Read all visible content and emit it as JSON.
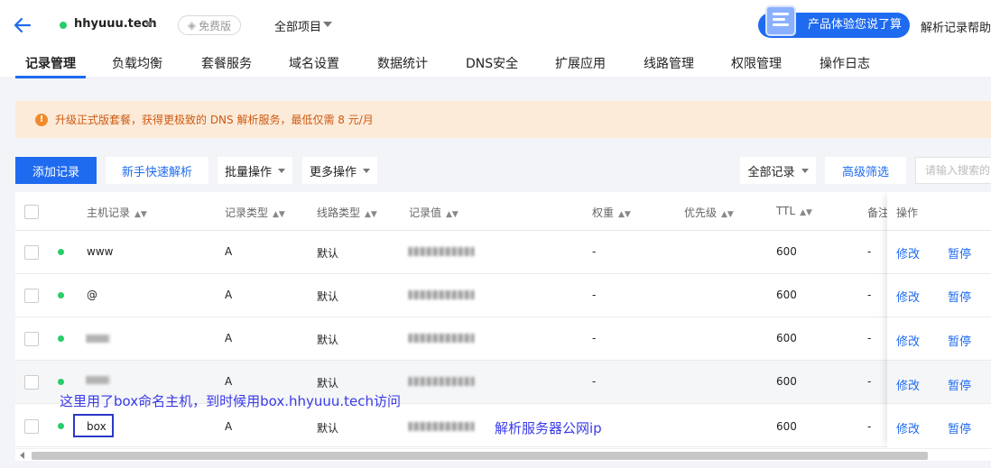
{
  "header": {
    "domain": "hhyuuu.tech",
    "plan_badge": "免费版",
    "project_filter": "全部项目",
    "promo_label": "产品体验您说了算",
    "help_text": "解析记录帮助指南"
  },
  "tabs": [
    {
      "label": "记录管理",
      "active": true
    },
    {
      "label": "负载均衡"
    },
    {
      "label": "套餐服务"
    },
    {
      "label": "域名设置"
    },
    {
      "label": "数据统计"
    },
    {
      "label": "DNS安全"
    },
    {
      "label": "扩展应用"
    },
    {
      "label": "线路管理"
    },
    {
      "label": "权限管理"
    },
    {
      "label": "操作日志"
    }
  ],
  "notice": {
    "icon": "warning-icon",
    "text": "升级正式版套餐，获得更极致的 DNS 解析服务，最低仅需 8 元/月",
    "color": "#cc5a12"
  },
  "toolbar": {
    "add_record": "添加记录",
    "quick_setup": "新手快速解析",
    "batch_ops": "批量操作",
    "more_ops": "更多操作",
    "all_records": "全部记录",
    "advanced_filter": "高级筛选",
    "search_placeholder": "请输入搜索的"
  },
  "table": {
    "columns": [
      "主机记录",
      "记录类型",
      "线路类型",
      "记录值",
      "权重",
      "优先级",
      "TTL",
      "备注",
      "操作"
    ],
    "rows": [
      {
        "host": "www",
        "type": "A",
        "line": "默认",
        "weight": "-",
        "ttl": "600",
        "note": "-",
        "edit": "修改",
        "pause": "暂停"
      },
      {
        "host": "@",
        "type": "A",
        "line": "默认",
        "weight": "-",
        "ttl": "600",
        "note": "-",
        "edit": "修改",
        "pause": "暂停"
      },
      {
        "host": "",
        "type": "A",
        "line": "默认",
        "weight": "-",
        "ttl": "600",
        "note": "-",
        "edit": "修改",
        "pause": "暂停"
      },
      {
        "host": "",
        "type": "A",
        "line": "默认",
        "weight": "-",
        "ttl": "600",
        "note": "-",
        "edit": "修改",
        "pause": "暂停"
      },
      {
        "host": "box",
        "type": "A",
        "line": "默认",
        "weight": "",
        "ttl": "600",
        "note": "-",
        "edit": "修改",
        "pause": "暂停"
      }
    ]
  },
  "annotations": {
    "host_note": "这里用了box命名主机，到时候用box.hhyuuu.tech访问",
    "ip_note": "解析服务器公网ip"
  },
  "colors": {
    "accent": "#1f6bf0",
    "status_green": "#29cc6a",
    "annotation": "#3a3ae8"
  }
}
